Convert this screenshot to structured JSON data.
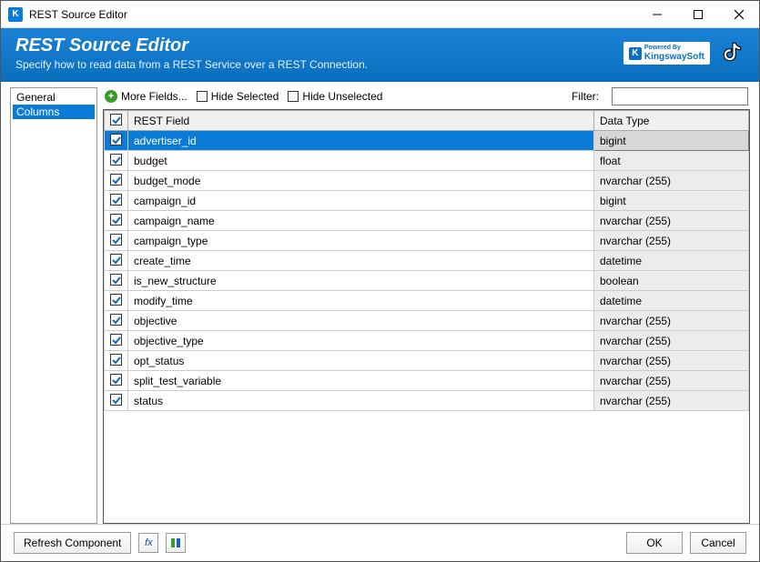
{
  "window": {
    "title": "REST Source Editor",
    "header_title": "REST Source Editor",
    "header_subtitle": "Specify how to read data from a REST Service over a REST Connection.",
    "powered_by": "Powered By",
    "brand": "KingswaySoft"
  },
  "sidebar": {
    "items": [
      {
        "label": "General",
        "selected": false
      },
      {
        "label": "Columns",
        "selected": true
      }
    ]
  },
  "toolbar": {
    "more_fields": "More Fields...",
    "hide_selected": "Hide Selected",
    "hide_unselected": "Hide Unselected",
    "filter_label": "Filter:",
    "filter_value": ""
  },
  "table": {
    "headers": {
      "field": "REST Field",
      "type": "Data Type"
    },
    "header_checked": true,
    "rows": [
      {
        "checked": true,
        "field": "advertiser_id",
        "type": "bigint",
        "selected": true
      },
      {
        "checked": true,
        "field": "budget",
        "type": "float",
        "selected": false
      },
      {
        "checked": true,
        "field": "budget_mode",
        "type": "nvarchar (255)",
        "selected": false
      },
      {
        "checked": true,
        "field": "campaign_id",
        "type": "bigint",
        "selected": false
      },
      {
        "checked": true,
        "field": "campaign_name",
        "type": "nvarchar (255)",
        "selected": false
      },
      {
        "checked": true,
        "field": "campaign_type",
        "type": "nvarchar (255)",
        "selected": false
      },
      {
        "checked": true,
        "field": "create_time",
        "type": "datetime",
        "selected": false
      },
      {
        "checked": true,
        "field": "is_new_structure",
        "type": "boolean",
        "selected": false
      },
      {
        "checked": true,
        "field": "modify_time",
        "type": "datetime",
        "selected": false
      },
      {
        "checked": true,
        "field": "objective",
        "type": "nvarchar (255)",
        "selected": false
      },
      {
        "checked": true,
        "field": "objective_type",
        "type": "nvarchar (255)",
        "selected": false
      },
      {
        "checked": true,
        "field": "opt_status",
        "type": "nvarchar (255)",
        "selected": false
      },
      {
        "checked": true,
        "field": "split_test_variable",
        "type": "nvarchar (255)",
        "selected": false
      },
      {
        "checked": true,
        "field": "status",
        "type": "nvarchar (255)",
        "selected": false
      }
    ]
  },
  "footer": {
    "refresh": "Refresh Component",
    "ok": "OK",
    "cancel": "Cancel"
  }
}
